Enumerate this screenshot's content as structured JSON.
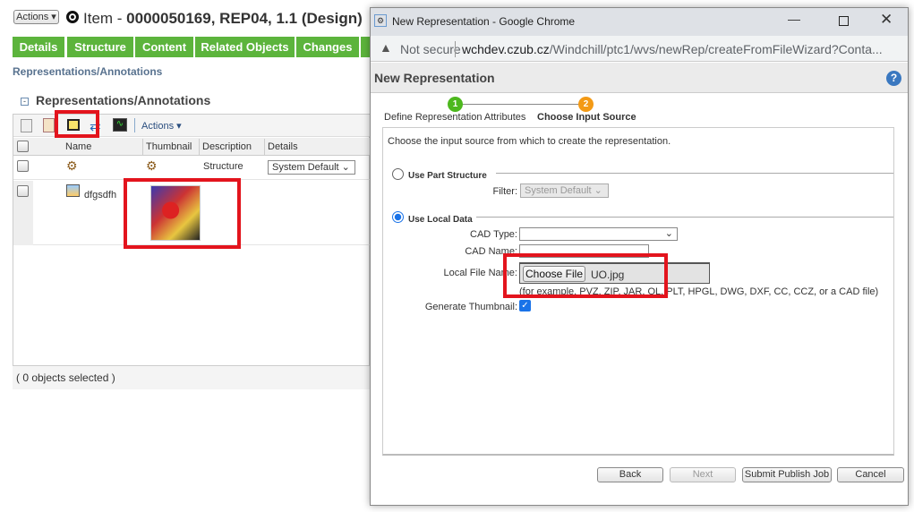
{
  "page": {
    "actions_label": "Actions",
    "title_prefix": "Item - ",
    "title_bold": "0000050169, REP04, 1.1 (Design)",
    "tabs": [
      "Details",
      "Structure",
      "Content",
      "Related Objects",
      "Changes"
    ],
    "breadcrumb": "Representations/Annotations",
    "section_title": "Representations/Annotations",
    "toolbar_actions": "Actions",
    "columns": [
      "Name",
      "Thumbnail",
      "Description",
      "Details"
    ],
    "rows": [
      {
        "name": "",
        "description": "Structure",
        "details": "System Default"
      },
      {
        "name": "dfgsdfh",
        "description": "",
        "details": ""
      }
    ],
    "footer": "( 0 objects selected )"
  },
  "popup": {
    "window_title": "New Representation - Google Chrome",
    "not_secure": "Not secure",
    "url_host": "wchdev.czub.cz",
    "url_path": "/Windchill/ptc1/wvs/newRep/createFromFileWizard?Conta...",
    "header": "New Representation",
    "steps": [
      {
        "num": "1",
        "label": "Define Representation Attributes",
        "color": "#4db81e"
      },
      {
        "num": "2",
        "label": "Choose Input Source",
        "color": "#f39a16"
      }
    ],
    "instruction": "Choose the input source from which to create the representation.",
    "use_part_structure": "Use Part Structure",
    "filter_label": "Filter:",
    "filter_value": "System Default",
    "use_local_data": "Use Local Data",
    "cad_type_label": "CAD Type:",
    "cad_type_value": "",
    "cad_name_label": "CAD Name:",
    "cad_name_value": "",
    "local_file_label": "Local File Name:",
    "choose_file": "Choose File",
    "file_name": "UO.jpg",
    "file_hint": "(for example, PVZ, ZIP, JAR, OL, PLT, HPGL, DWG, DXF, CC, CCZ, or a CAD file)",
    "generate_thumbnail_label": "Generate Thumbnail:",
    "generate_thumbnail": true,
    "buttons": {
      "back": "Back",
      "next": "Next",
      "submit": "Submit Publish Job",
      "cancel": "Cancel"
    }
  }
}
